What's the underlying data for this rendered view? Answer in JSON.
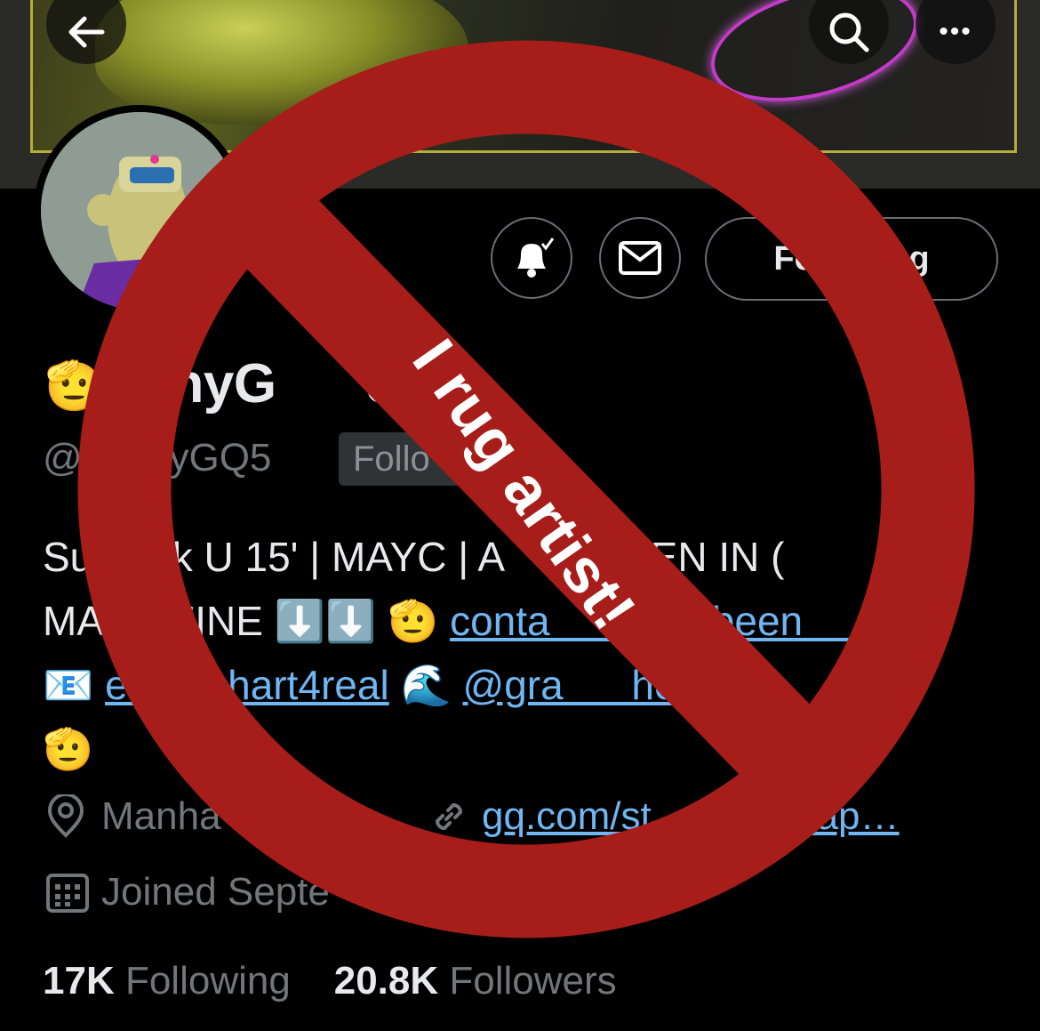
{
  "header": {
    "back_icon": "arrow-left-icon",
    "search_icon": "search-icon",
    "more_icon": "more-horizontal-icon",
    "more_label": "•••"
  },
  "actions": {
    "notify_icon": "bell-check-icon",
    "message_icon": "mail-icon",
    "following_label": "Fo          g"
  },
  "profile": {
    "display_name_prefix": "🫡",
    "display_name": "onnyG      eth",
    "handle": "@      nyGQ5",
    "follows_you": "Follo      u",
    "bio_line1": "Su       k U 15' | MAYC | A     RITTEN IN (",
    "bio_line2_text": "MA      ZINE ⬇️⬇️ 🫡 ",
    "bio_line2_link": "conta       @vybeen      m",
    "bio_line3_prefix": "📧 ",
    "bio_line3_link1": "e      inhart4real",
    "bio_line3_mid": " 🌊 ",
    "bio_line3_link2": "@gra      heft",
    "bio_line4": "🫡",
    "location": "Manha        IY",
    "url": "gq.com/st          ed-ap…",
    "joined": "Joined Septe"
  },
  "stats": {
    "following_count": "17K",
    "following_label": "Following",
    "followers_count": "20.8K",
    "followers_label": "Followers"
  },
  "overlay": {
    "text": "I rug artist!",
    "color": "#a61d1a"
  },
  "colors": {
    "background": "#000000",
    "text_primary": "#e7e9ea",
    "text_secondary": "#71767b",
    "link": "#6fb6f2"
  }
}
